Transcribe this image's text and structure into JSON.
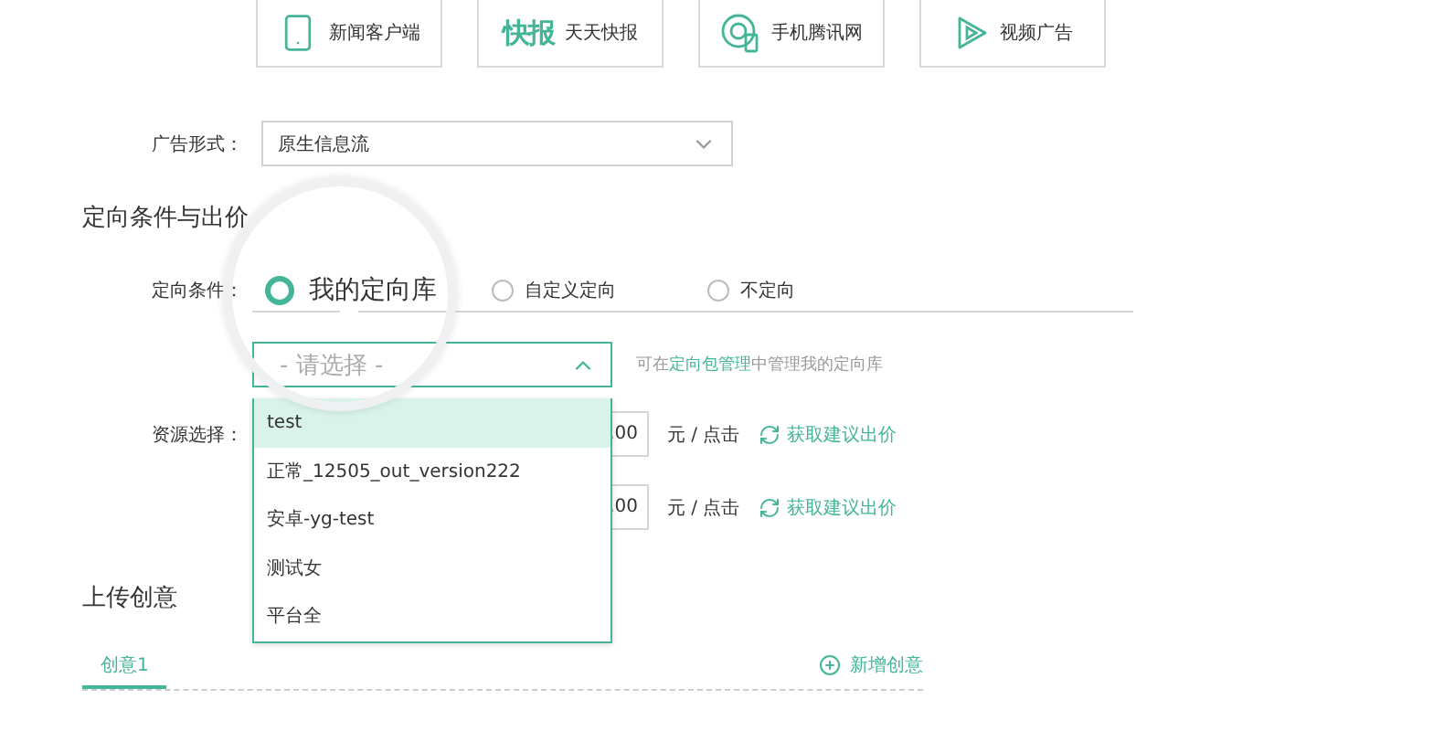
{
  "platforms": [
    {
      "kind": "app",
      "label": "新闻客户端"
    },
    {
      "kind": "logo",
      "logo_text": "快报",
      "label": "天天快报"
    },
    {
      "kind": "site",
      "label": "手机腾讯网"
    },
    {
      "kind": "video",
      "label": "视频广告"
    }
  ],
  "ad_format": {
    "label": "广告形式：",
    "value": "原生信息流"
  },
  "section_title": "定向条件与出价",
  "targeting": {
    "label": "定向条件：",
    "options": [
      {
        "label": "我的定向库",
        "selected": true
      },
      {
        "label": "自定义定向",
        "selected": false
      },
      {
        "label": "不定向",
        "selected": false
      }
    ]
  },
  "library_select": {
    "placeholder": "- 请选择 -",
    "expanded": true,
    "options": [
      {
        "label": "test",
        "selected": true
      },
      {
        "label": "正常_12505_out_version222",
        "selected": false
      },
      {
        "label": "安卓-yg-test",
        "selected": false
      },
      {
        "label": "测试女",
        "selected": false
      },
      {
        "label": "平台全",
        "selected": false
      }
    ],
    "hint_before": "可在",
    "hint_link": "定向包管理",
    "hint_after": "中管理我的定向库"
  },
  "resources": {
    "label": "资源选择：",
    "rows": [
      {
        "value": ".00",
        "unit": "元 / 点击",
        "action": "获取建议出价"
      },
      {
        "value": ".00",
        "unit": "元 / 点击",
        "action": "获取建议出价"
      }
    ]
  },
  "creatives": {
    "title": "上传创意",
    "tabs": [
      {
        "label": "创意1",
        "selected": true
      }
    ],
    "add": "新增创意"
  }
}
